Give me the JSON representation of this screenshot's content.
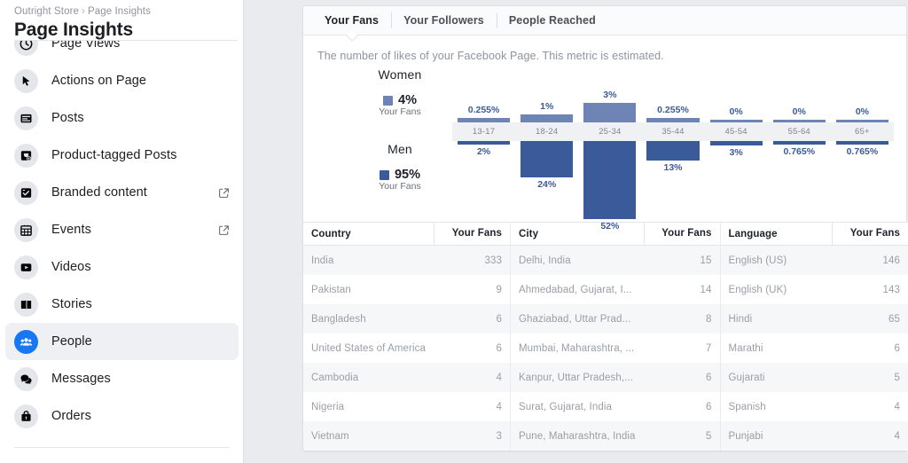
{
  "sidebar": {
    "breadcrumb": {
      "parent": "Outright Store",
      "separator": "›",
      "current": "Page Insights"
    },
    "page_title": "Page Insights",
    "items": [
      {
        "label": "Page Views",
        "icon": "clock-icon",
        "external": false,
        "active": false,
        "partial": true
      },
      {
        "label": "Actions on Page",
        "icon": "cursor-icon",
        "external": false,
        "active": false
      },
      {
        "label": "Posts",
        "icon": "article-icon",
        "external": false,
        "active": false
      },
      {
        "label": "Product-tagged Posts",
        "icon": "product-tag-icon",
        "external": false,
        "active": false
      },
      {
        "label": "Branded content",
        "icon": "badge-check-icon",
        "external": true,
        "active": false
      },
      {
        "label": "Events",
        "icon": "calendar-icon",
        "external": true,
        "active": false
      },
      {
        "label": "Videos",
        "icon": "video-play-icon",
        "external": false,
        "active": false
      },
      {
        "label": "Stories",
        "icon": "book-icon",
        "external": false,
        "active": false
      },
      {
        "label": "People",
        "icon": "people-icon",
        "external": false,
        "active": true
      },
      {
        "label": "Messages",
        "icon": "chat-bubbles-icon",
        "external": false,
        "active": false
      },
      {
        "label": "Orders",
        "icon": "shopping-bag-icon",
        "external": false,
        "active": false
      }
    ]
  },
  "main": {
    "tabs": [
      {
        "label": "Your Fans",
        "active": true
      },
      {
        "label": "Your Followers",
        "active": false
      },
      {
        "label": "People Reached",
        "active": false
      }
    ],
    "metric_note": "The number of likes of your Facebook Page. This metric is estimated."
  },
  "chart_data": {
    "type": "bar",
    "title": "",
    "xlabel": "",
    "ylabel": "",
    "orientation": "vertical-diverging",
    "grid": false,
    "legend_position": "left",
    "categories": [
      "13-17",
      "18-24",
      "25-34",
      "35-44",
      "45-54",
      "55-64",
      "65+"
    ],
    "series": [
      {
        "name": "Women",
        "legend_pct": "4%",
        "legend_sub": "Your Fans",
        "color": "#6d84b4",
        "direction": "up",
        "labels": [
          "0.255%",
          "1%",
          "3%",
          "0.255%",
          "0%",
          "0%",
          "0%"
        ],
        "values": [
          0.255,
          1,
          3,
          0.255,
          0,
          0,
          0
        ]
      },
      {
        "name": "Men",
        "legend_pct": "95%",
        "legend_sub": "Your Fans",
        "color": "#3b5a9a",
        "direction": "down",
        "labels": [
          "2%",
          "24%",
          "52%",
          "13%",
          "3%",
          "0.765%",
          "0.765%"
        ],
        "values": [
          2,
          24,
          52,
          13,
          3,
          0.765,
          0.765
        ]
      }
    ],
    "ylim": [
      0,
      52
    ]
  },
  "tables": [
    {
      "id": "country-table",
      "headers": [
        "Country",
        "Your Fans"
      ],
      "rows": [
        [
          "India",
          "333"
        ],
        [
          "Pakistan",
          "9"
        ],
        [
          "Bangladesh",
          "6"
        ],
        [
          "United States of America",
          "6"
        ],
        [
          "Cambodia",
          "4"
        ],
        [
          "Nigeria",
          "4"
        ],
        [
          "Vietnam",
          "3"
        ]
      ]
    },
    {
      "id": "city-table",
      "headers": [
        "City",
        "Your Fans"
      ],
      "rows": [
        [
          "Delhi, India",
          "15"
        ],
        [
          "Ahmedabad, Gujarat, I...",
          "14"
        ],
        [
          "Ghaziabad, Uttar Prad...",
          "8"
        ],
        [
          "Mumbai, Maharashtra, ...",
          "7"
        ],
        [
          "Kanpur, Uttar Pradesh,...",
          "6"
        ],
        [
          "Surat, Gujarat, India",
          "6"
        ],
        [
          "Pune, Maharashtra, India",
          "5"
        ]
      ]
    },
    {
      "id": "language-table",
      "headers": [
        "Language",
        "Your Fans"
      ],
      "rows": [
        [
          "English (US)",
          "146"
        ],
        [
          "English (UK)",
          "143"
        ],
        [
          "Hindi",
          "65"
        ],
        [
          "Marathi",
          "6"
        ],
        [
          "Gujarati",
          "5"
        ],
        [
          "Spanish",
          "4"
        ],
        [
          "Punjabi",
          "4"
        ]
      ]
    }
  ],
  "colors": {
    "page_bg": "#e9ebee",
    "card_bg": "#ffffff",
    "accent": "#1877f2",
    "women_bar": "#6d84b4",
    "men_bar": "#3b5a9a",
    "row_alt": "#f6f7f8"
  }
}
